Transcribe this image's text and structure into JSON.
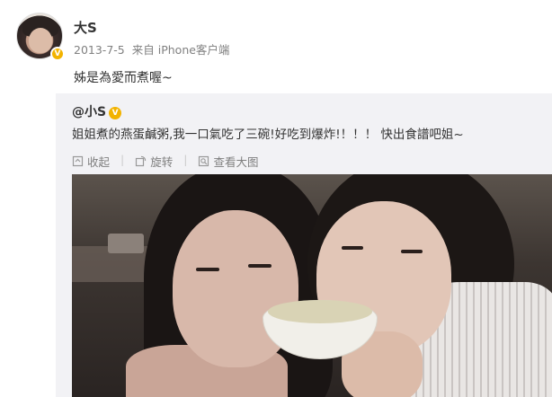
{
  "post": {
    "author": "大S",
    "verified_badge": "V",
    "date": "2013-7-5",
    "source_prefix": "来自",
    "source": "iPhone客户端",
    "content": "姊是為愛而煮喔~"
  },
  "repost": {
    "author": "@小S",
    "verified_badge": "V",
    "text": "姐姐煮的燕蛋鹹粥,我一口氣吃了三碗!好吃到爆炸!！！！ 快出食譜吧姐~",
    "actions": {
      "collect": "收起",
      "rotate": "旋转",
      "view_large": "查看大图"
    },
    "separator": "|"
  },
  "colors": {
    "badge": "#f2b300",
    "repost_bg": "#f2f2f5",
    "meta_text": "#808080"
  }
}
